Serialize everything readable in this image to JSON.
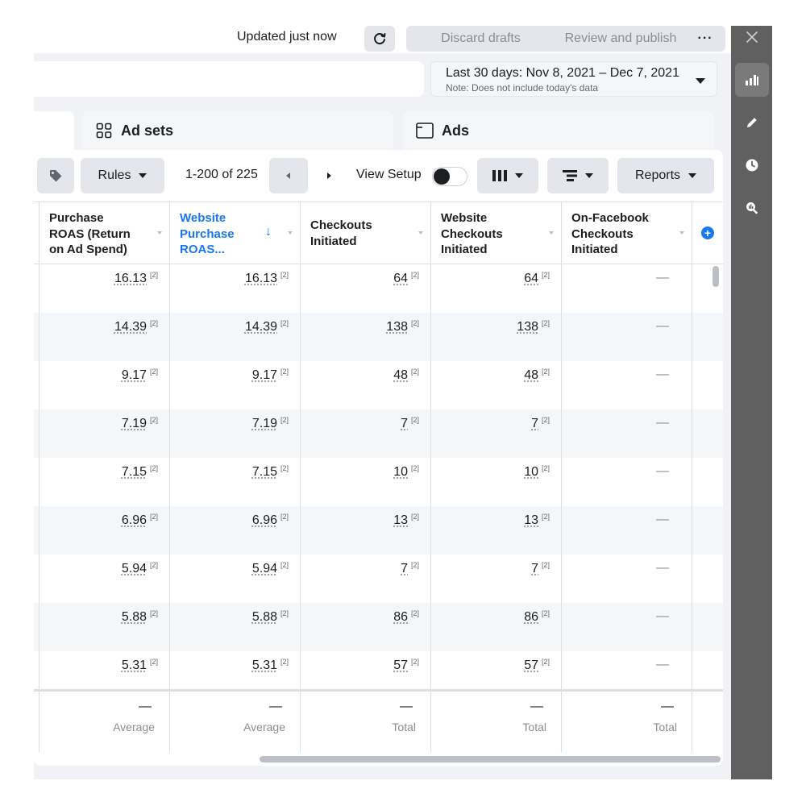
{
  "header": {
    "status_text": "Updated just now",
    "discard_label": "Discard drafts",
    "review_label": "Review and publish",
    "more_label": "···"
  },
  "date_range": {
    "main": "Last 30 days: Nov 8, 2021 – Dec 7, 2021",
    "note": "Note: Does not include today's data"
  },
  "tabs": [
    {
      "label": "Ad sets",
      "icon": "grid-icon"
    },
    {
      "label": "Ads",
      "icon": "ad-icon"
    }
  ],
  "toolbar": {
    "rules_label": "Rules",
    "page_count": "1-200 of 225",
    "view_setup_label": "View Setup",
    "reports_label": "Reports"
  },
  "table": {
    "columns": [
      {
        "label": "Purchase ROAS (Return on Ad Spend)",
        "label_lines": [
          "Purchase",
          "ROAS (Return",
          "on Ad Spend)"
        ]
      },
      {
        "label": "Website Purchase ROAS...",
        "label_lines": [
          "Website",
          "Purchase",
          "ROAS..."
        ],
        "sorted": true
      },
      {
        "label": "Checkouts Initiated",
        "label_lines": [
          "Checkouts",
          "Initiated"
        ]
      },
      {
        "label": "Website Checkouts Initiated",
        "label_lines": [
          "Website",
          "Checkouts",
          "Initiated"
        ]
      },
      {
        "label": "On-Facebook Checkouts Initiated",
        "label_lines": [
          "On-Facebook",
          "Checkouts",
          "Initiated"
        ]
      }
    ],
    "attribution_marker": "[2]",
    "empty_marker": "—",
    "rows": [
      {
        "roas": "16.13",
        "web_roas": "16.13",
        "checkouts": "64",
        "web_checkouts": "64",
        "fb_checkouts": "—"
      },
      {
        "roas": "14.39",
        "web_roas": "14.39",
        "checkouts": "138",
        "web_checkouts": "138",
        "fb_checkouts": "—"
      },
      {
        "roas": "9.17",
        "web_roas": "9.17",
        "checkouts": "48",
        "web_checkouts": "48",
        "fb_checkouts": "—"
      },
      {
        "roas": "7.19",
        "web_roas": "7.19",
        "checkouts": "7",
        "web_checkouts": "7",
        "fb_checkouts": "—"
      },
      {
        "roas": "7.15",
        "web_roas": "7.15",
        "checkouts": "10",
        "web_checkouts": "10",
        "fb_checkouts": "—"
      },
      {
        "roas": "6.96",
        "web_roas": "6.96",
        "checkouts": "13",
        "web_checkouts": "13",
        "fb_checkouts": "—"
      },
      {
        "roas": "5.94",
        "web_roas": "5.94",
        "checkouts": "7",
        "web_checkouts": "7",
        "fb_checkouts": "—"
      },
      {
        "roas": "5.88",
        "web_roas": "5.88",
        "checkouts": "86",
        "web_checkouts": "86",
        "fb_checkouts": "—"
      },
      {
        "roas": "5.31",
        "web_roas": "5.31",
        "checkouts": "57",
        "web_checkouts": "57",
        "fb_checkouts": "—"
      }
    ],
    "footer": [
      {
        "value": "—",
        "label": "Average"
      },
      {
        "value": "—",
        "label": "Average"
      },
      {
        "value": "—",
        "label": "Total"
      },
      {
        "value": "—",
        "label": "Total"
      },
      {
        "value": "—",
        "label": "Total"
      }
    ]
  },
  "colors": {
    "accent": "#1877f2",
    "sidebar": "#606060",
    "button_bg": "#e4e6eb",
    "row_alt": "#f5f6f7"
  }
}
